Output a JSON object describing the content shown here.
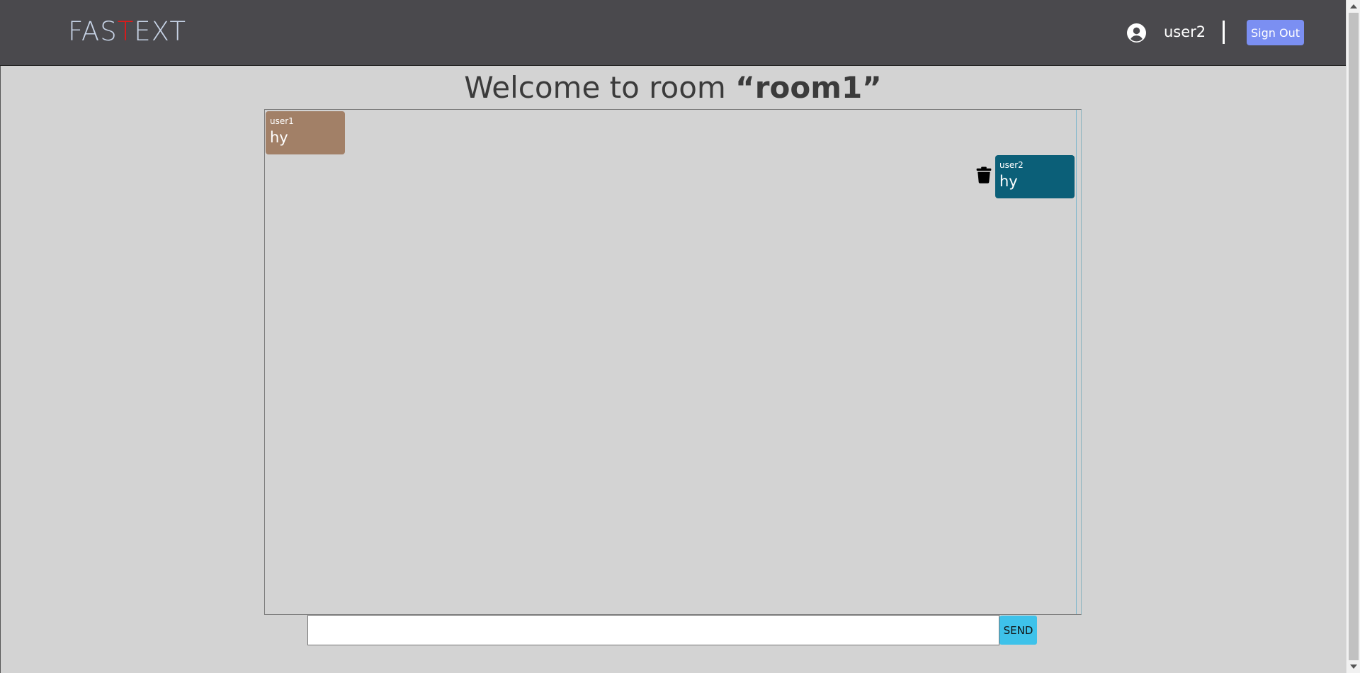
{
  "navbar": {
    "logo_prefix": "FAS",
    "logo_accent": "T",
    "logo_suffix": "EXT",
    "username": "user2",
    "signout_label": "Sign Out",
    "user_icon": "user-circle-icon"
  },
  "room": {
    "title_prefix": "Welcome to room ",
    "room_name": "“room1”"
  },
  "messages": [
    {
      "sender": "user1",
      "text": "hy",
      "direction": "incoming",
      "color": "#a28067"
    },
    {
      "sender": "user2",
      "text": "hy",
      "direction": "outgoing",
      "color": "#0b5f78",
      "action_icon": "trash-icon"
    }
  ],
  "composer": {
    "input_value": "",
    "send_label": "SEND"
  },
  "colors": {
    "navbar_bg": "#4a494d",
    "logo_accent": "#e01818",
    "signout_bg": "#7b8ff2",
    "send_bg": "#3ec2ea",
    "page_bg": "#d3d3d3"
  }
}
